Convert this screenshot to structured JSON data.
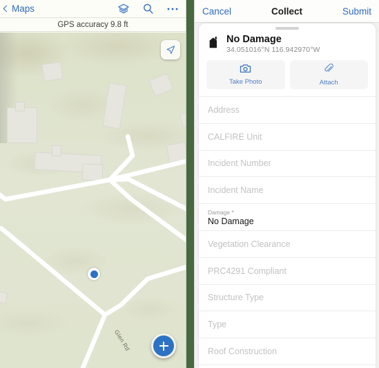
{
  "map_panel": {
    "back_label": "Maps",
    "icons": [
      {
        "name": "layers-icon",
        "label": "Layers"
      },
      {
        "name": "search-icon",
        "label": "Search"
      },
      {
        "name": "more-icon",
        "label": "More"
      }
    ],
    "gps_status": "GPS accuracy 9.8 ft",
    "locate_button": "Locate",
    "add_button": "+",
    "road_label": "Glen Rd",
    "user_location": "current-location"
  },
  "form_panel": {
    "nav": {
      "cancel": "Cancel",
      "title": "Collect",
      "submit": "Submit"
    },
    "feature": {
      "title": "No Damage",
      "coordinates": "34.051016°N  116.942970°W",
      "icon": "building-icon"
    },
    "actions": [
      {
        "label": "Take Photo",
        "icon": "camera-icon"
      },
      {
        "label": "Attach",
        "icon": "paperclip-icon"
      }
    ],
    "fields": [
      {
        "label": "Address",
        "value": "",
        "filled": false
      },
      {
        "label": "CALFIRE Unit",
        "value": "",
        "filled": false
      },
      {
        "label": "Incident Number",
        "value": "",
        "filled": false
      },
      {
        "label": "Incident Name",
        "value": "",
        "filled": false
      },
      {
        "label": "Damage *",
        "value": "No Damage",
        "filled": true
      },
      {
        "label": "Vegetation Clearance",
        "value": "",
        "filled": false
      },
      {
        "label": "PRC4291 Compliant",
        "value": "",
        "filled": false
      },
      {
        "label": "Structure Type",
        "value": "",
        "filled": false
      },
      {
        "label": "Type",
        "value": "",
        "filled": false
      },
      {
        "label": "Roof Construction",
        "value": "",
        "filled": false
      }
    ]
  },
  "colors": {
    "accent_blue": "#2f6bbf",
    "map_green": "#dfe3cd",
    "divider_green": "#46693f",
    "road_white": "#ffffff"
  }
}
